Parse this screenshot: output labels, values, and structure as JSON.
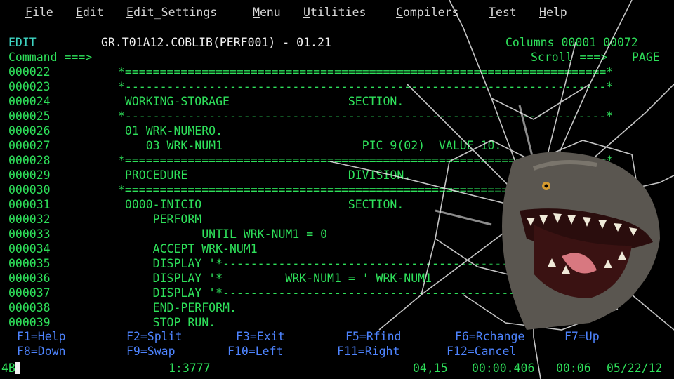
{
  "menu": [
    {
      "key": "F",
      "rest": "ile"
    },
    {
      "key": "E",
      "rest": "dit"
    },
    {
      "key": "E",
      "rest": "dit_Settings"
    },
    {
      "key": "M",
      "rest": "enu"
    },
    {
      "key": "U",
      "rest": "tilities"
    },
    {
      "key": "C",
      "rest": "ompilers"
    },
    {
      "key": "T",
      "rest": "est"
    },
    {
      "key": "H",
      "rest": "elp"
    }
  ],
  "header": {
    "mode": "EDIT",
    "dataset": "GR.T01A12.COBLIB(PERF001) - 01.21",
    "columns": "Columns 00001 00072",
    "command_label": "Command ===>",
    "command_value": "",
    "scroll_label": "Scroll ===>",
    "scroll_value": "PAGE"
  },
  "lines": [
    {
      "num": "000022",
      "text": "*=====================================================================*"
    },
    {
      "num": "000023",
      "text": "*---------------------------------------------------------------------*"
    },
    {
      "num": "000024",
      "text": " WORKING-STORAGE                 SECTION."
    },
    {
      "num": "000025",
      "text": "*---------------------------------------------------------------------*"
    },
    {
      "num": "000026",
      "text": " 01 WRK-NUMERO."
    },
    {
      "num": "000027",
      "text": "    03 WRK-NUM1                    PIC 9(02)  VALUE 10."
    },
    {
      "num": "000028",
      "text": "*=====================================================================*"
    },
    {
      "num": "000029",
      "text": " PROCEDURE                       DIVISION."
    },
    {
      "num": "000030",
      "text": "*=====================================================================*"
    },
    {
      "num": "000031",
      "text": " 0000-INICIO                     SECTION."
    },
    {
      "num": "000032",
      "text": "     PERFORM"
    },
    {
      "num": "000033",
      "text": "            UNTIL WRK-NUM1 = 0"
    },
    {
      "num": "000034",
      "text": "     ACCEPT WRK-NUM1"
    },
    {
      "num": "000035",
      "text": "     DISPLAY '*-----------------------------------------------*'"
    },
    {
      "num": "000036",
      "text": "     DISPLAY '*         WRK-NUM1 = ' WRK-NUM1"
    },
    {
      "num": "000037",
      "text": "     DISPLAY '*-----------------------------------------------*'"
    },
    {
      "num": "000038",
      "text": "     END-PERFORM."
    },
    {
      "num": "000039",
      "text": "     STOP RUN."
    }
  ],
  "fkeys_row1": [
    "F1=Help",
    "F2=Split",
    "F3=Exit",
    "F5=Rfind",
    "F6=Rchange",
    "F7=Up"
  ],
  "fkeys_row2": [
    "F8=Down",
    "F9=Swap",
    "F10=Left",
    "F11=Right",
    "F12=Cancel"
  ],
  "status": {
    "session": "4B",
    "message": "1:3777",
    "cursor_pos": "04,15",
    "timer": "00:00.406",
    "time": "00:06",
    "date": "05/22/12"
  },
  "colors": {
    "text_green": "#2ee05a",
    "menu_text": "#d8d8d8",
    "fkey_blue": "#4e84ff",
    "dataset_white": "#f2f2f2"
  }
}
